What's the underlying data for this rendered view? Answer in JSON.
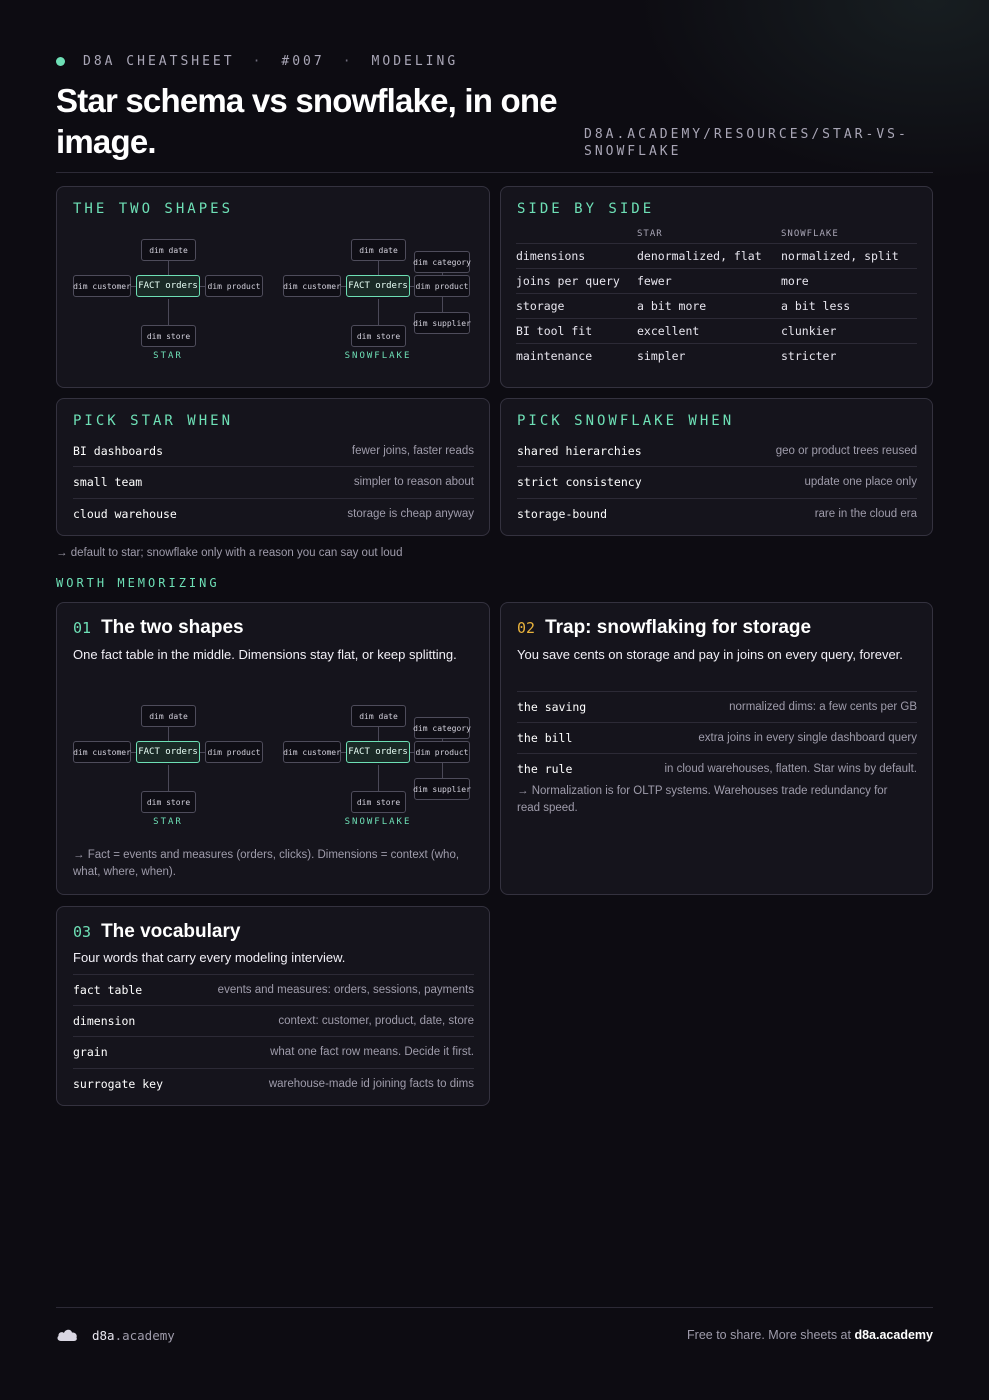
{
  "header": {
    "eyebrow": [
      "D8A CHEATSHEET",
      "#007",
      "MODELING"
    ],
    "eyebrow_sep": "·",
    "title": "Star schema vs snowflake, in one image.",
    "url": "D8A.ACADEMY/RESOURCES/STAR-VS-SNOWFLAKE"
  },
  "diagram": {
    "star": {
      "label": "STAR",
      "fact": "FACT orders",
      "dims": {
        "top": "dim date",
        "left": "dim customer",
        "right": "dim product",
        "bottom": "dim store"
      }
    },
    "snowflake": {
      "label": "SNOWFLAKE",
      "fact": "FACT orders",
      "dims": {
        "top": "dim date",
        "left": "dim customer",
        "right": "dim product",
        "bottom": "dim store",
        "category": "dim category",
        "supplier": "dim supplier"
      }
    }
  },
  "two_shapes": {
    "heading": "THE TWO SHAPES"
  },
  "side_by_side": {
    "heading": "SIDE BY SIDE",
    "columns": [
      "",
      "STAR",
      "SNOWFLAKE"
    ],
    "rows": [
      [
        "dimensions",
        "denormalized, flat",
        "normalized, split"
      ],
      [
        "joins per query",
        "fewer",
        "more"
      ],
      [
        "storage",
        "a bit more",
        "a bit less"
      ],
      [
        "BI tool fit",
        "excellent",
        "clunkier"
      ],
      [
        "maintenance",
        "simpler",
        "stricter"
      ]
    ]
  },
  "pick_star": {
    "heading": "PICK STAR WHEN",
    "rows": [
      {
        "k": "BI dashboards",
        "v": "fewer joins, faster reads"
      },
      {
        "k": "small team",
        "v": "simpler to reason about"
      },
      {
        "k": "cloud warehouse",
        "v": "storage is cheap anyway"
      }
    ]
  },
  "pick_snowflake": {
    "heading": "PICK SNOWFLAKE WHEN",
    "rows": [
      {
        "k": "shared hierarchies",
        "v": "geo or product trees reused"
      },
      {
        "k": "strict consistency",
        "v": "update one place only"
      },
      {
        "k": "storage-bound",
        "v": "rare in the cloud era"
      }
    ]
  },
  "default_note": "→ default to star; snowflake only with a reason you can say out loud",
  "section_title": "WORTH MEMORIZING",
  "cards": [
    {
      "num": "01",
      "title": "The two shapes",
      "desc": "One fact table in the middle. Dimensions stay flat, or keep splitting.",
      "note": "→ Fact = events and measures (orders, clicks). Dimensions = context (who, what, where, when)."
    },
    {
      "num": "02",
      "title": "Trap: snowflaking for storage",
      "desc": "You save cents on storage and pay in joins on every query, forever.",
      "rows": [
        {
          "k": "the saving",
          "v": "normalized dims: a few cents per GB"
        },
        {
          "k": "the bill",
          "v": "extra joins in every single dashboard query"
        },
        {
          "k": "the rule",
          "v": "in cloud warehouses, flatten. Star wins by default."
        }
      ],
      "note": "→ Normalization is for OLTP systems. Warehouses trade redundancy for read speed."
    },
    {
      "num": "03",
      "title": "The vocabulary",
      "desc": "Four words that carry every modeling interview.",
      "rows": [
        {
          "k": "fact table",
          "v": "events and measures: orders, sessions, payments"
        },
        {
          "k": "dimension",
          "v": "context: customer, product, date, store"
        },
        {
          "k": "grain",
          "v": "what one fact row means. Decide it first."
        },
        {
          "k": "surrogate key",
          "v": "warehouse-made id joining facts to dims"
        }
      ]
    }
  ],
  "footer": {
    "brand_main": "d8a",
    "brand_rest": ".academy",
    "right_text": "Free to share. More sheets at ",
    "right_link": "d8a.academy"
  },
  "colors": {
    "accent": "#6ee0b6",
    "warn": "#e8b23c",
    "bg": "#0d0c12",
    "card": "#15141c"
  }
}
